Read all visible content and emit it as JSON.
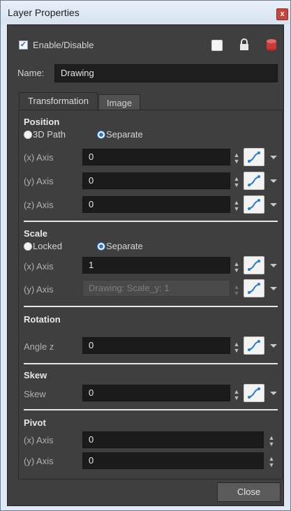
{
  "window": {
    "title": "Layer Properties",
    "close_glyph": "x"
  },
  "header": {
    "enable_label": "Enable/Disable",
    "enable_checked": true,
    "icons": [
      "color-swatch-icon",
      "lock-icon",
      "cylinder-icon"
    ]
  },
  "name_row": {
    "label": "Name:",
    "value": "Drawing"
  },
  "tabs": [
    {
      "label": "Transformation",
      "active": true
    },
    {
      "label": "Image",
      "active": false
    }
  ],
  "position": {
    "title": "Position",
    "mode_options": [
      "3D Path",
      "Separate"
    ],
    "selected": "Separate",
    "axes": [
      {
        "label": "(x) Axis",
        "value": "0"
      },
      {
        "label": "(y) Axis",
        "value": "0"
      },
      {
        "label": "(z) Axis",
        "value": "0"
      }
    ]
  },
  "scale": {
    "title": "Scale",
    "mode_options": [
      "Locked",
      "Separate"
    ],
    "selected": "Separate",
    "axes": [
      {
        "label": "(x) Axis",
        "value": "1",
        "disabled": false
      },
      {
        "label": "(y) Axis",
        "value": "Drawing: Scale_y: 1",
        "disabled": true
      }
    ]
  },
  "rotation": {
    "title": "Rotation",
    "label": "Angle z",
    "value": "0"
  },
  "skew": {
    "title": "Skew",
    "label": "Skew",
    "value": "0"
  },
  "pivot": {
    "title": "Pivot",
    "axes": [
      {
        "label": "(x) Axis",
        "value": "0"
      },
      {
        "label": "(y) Axis",
        "value": "0"
      }
    ]
  },
  "footer": {
    "close_label": "Close"
  },
  "colors": {
    "panel_bg": "#3f3f3f",
    "field_bg": "#1b1b1b",
    "accent": "#2a78d6",
    "title_bar": "#dfe9f5"
  }
}
